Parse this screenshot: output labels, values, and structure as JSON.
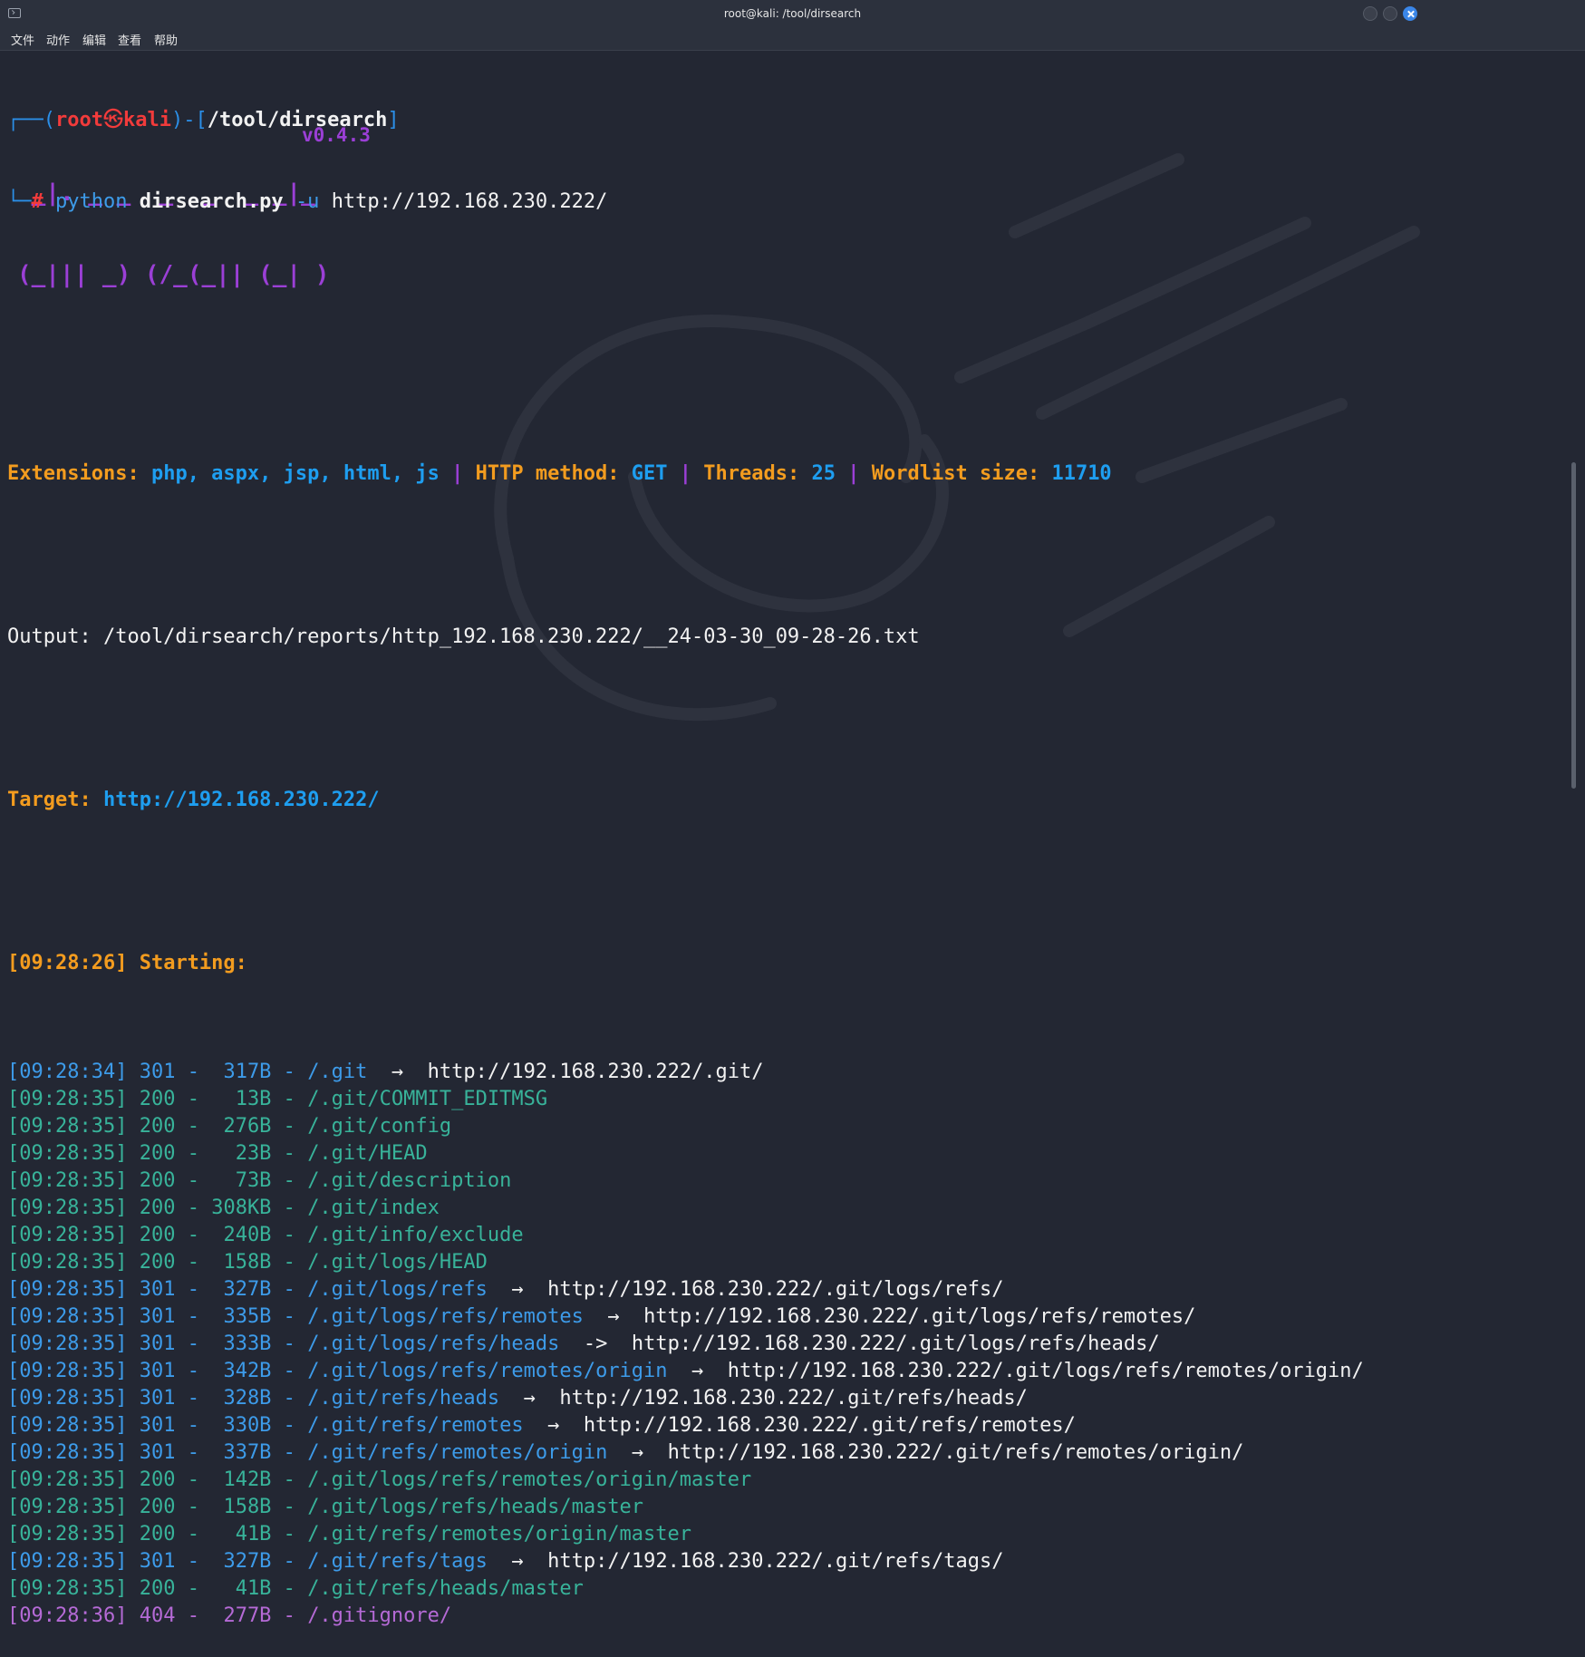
{
  "window": {
    "title": "root@kali: /tool/dirsearch"
  },
  "menu": [
    "文件",
    "动作",
    "编辑",
    "查看",
    "帮助"
  ],
  "prompt": {
    "open": "┌──(",
    "user": "root",
    "sym": "㉿",
    "host": "kali",
    "mid": ")-[",
    "path": "/tool/dirsearch",
    "close": "]",
    "second": "└─",
    "hash": "#",
    "cmd": "python",
    "script": "dirsearch.py",
    "flag": "-u",
    "url": "http://192.168.230.222/"
  },
  "banner": {
    "line1": " _|. _ _  _  _  _ _|_",
    "line2": "(_||| _) (/_(_|| (_| )",
    "version": "v0.4.3"
  },
  "config": {
    "ext_label": "Extensions:",
    "ext_value": "php, aspx, jsp, html, js",
    "method_label": "HTTP method:",
    "method_value": "GET",
    "threads_label": "Threads:",
    "threads_value": "25",
    "wordlist_label": "Wordlist size:",
    "wordlist_value": "11710",
    "sep": "|"
  },
  "output": "Output: /tool/dirsearch/reports/http_192.168.230.222/__24-03-30_09-28-26.txt",
  "target": {
    "label": "Target:",
    "url": "http://192.168.230.222/"
  },
  "starting": {
    "time": "[09:28:26]",
    "label": "Starting:"
  },
  "results": [
    {
      "time": "[09:28:34]",
      "status": "301",
      "size": "317B",
      "path": "/.git",
      "arrow": "→",
      "redirect": "http://192.168.230.222/.git/"
    },
    {
      "time": "[09:28:35]",
      "status": "200",
      "size": " 13B",
      "path": "/.git/COMMIT_EDITMSG"
    },
    {
      "time": "[09:28:35]",
      "status": "200",
      "size": "276B",
      "path": "/.git/config"
    },
    {
      "time": "[09:28:35]",
      "status": "200",
      "size": " 23B",
      "path": "/.git/HEAD"
    },
    {
      "time": "[09:28:35]",
      "status": "200",
      "size": " 73B",
      "path": "/.git/description"
    },
    {
      "time": "[09:28:35]",
      "status": "200",
      "size": "308KB",
      "path": "/.git/index"
    },
    {
      "time": "[09:28:35]",
      "status": "200",
      "size": "240B",
      "path": "/.git/info/exclude"
    },
    {
      "time": "[09:28:35]",
      "status": "200",
      "size": "158B",
      "path": "/.git/logs/HEAD"
    },
    {
      "time": "[09:28:35]",
      "status": "301",
      "size": "327B",
      "path": "/.git/logs/refs",
      "arrow": "→",
      "redirect": "http://192.168.230.222/.git/logs/refs/"
    },
    {
      "time": "[09:28:35]",
      "status": "301",
      "size": "335B",
      "path": "/.git/logs/refs/remotes",
      "arrow": "→",
      "redirect": "http://192.168.230.222/.git/logs/refs/remotes/"
    },
    {
      "time": "[09:28:35]",
      "status": "301",
      "size": "333B",
      "path": "/.git/logs/refs/heads",
      "arrow": "->",
      "redirect": "http://192.168.230.222/.git/logs/refs/heads/"
    },
    {
      "time": "[09:28:35]",
      "status": "301",
      "size": "342B",
      "path": "/.git/logs/refs/remotes/origin",
      "arrow": "→",
      "redirect": "http://192.168.230.222/.git/logs/refs/remotes/origin/"
    },
    {
      "time": "[09:28:35]",
      "status": "301",
      "size": "328B",
      "path": "/.git/refs/heads",
      "arrow": "→",
      "redirect": "http://192.168.230.222/.git/refs/heads/"
    },
    {
      "time": "[09:28:35]",
      "status": "301",
      "size": "330B",
      "path": "/.git/refs/remotes",
      "arrow": "→",
      "redirect": "http://192.168.230.222/.git/refs/remotes/"
    },
    {
      "time": "[09:28:35]",
      "status": "301",
      "size": "337B",
      "path": "/.git/refs/remotes/origin",
      "arrow": "→",
      "redirect": "http://192.168.230.222/.git/refs/remotes/origin/"
    },
    {
      "time": "[09:28:35]",
      "status": "200",
      "size": "142B",
      "path": "/.git/logs/refs/remotes/origin/master"
    },
    {
      "time": "[09:28:35]",
      "status": "200",
      "size": "158B",
      "path": "/.git/logs/refs/heads/master"
    },
    {
      "time": "[09:28:35]",
      "status": "200",
      "size": " 41B",
      "path": "/.git/refs/remotes/origin/master"
    },
    {
      "time": "[09:28:35]",
      "status": "301",
      "size": "327B",
      "path": "/.git/refs/tags",
      "arrow": "→",
      "redirect": "http://192.168.230.222/.git/refs/tags/"
    },
    {
      "time": "[09:28:35]",
      "status": "200",
      "size": " 41B",
      "path": "/.git/refs/heads/master"
    },
    {
      "time": "[09:28:36]",
      "status": "404",
      "size": "277B",
      "path": "/.gitignore/"
    }
  ],
  "colors": {
    "background": "#232733",
    "blue": "#2b8fe8",
    "orange": "#f39c1f",
    "purple": "#9b3fd6",
    "teal": "#38b39a"
  }
}
